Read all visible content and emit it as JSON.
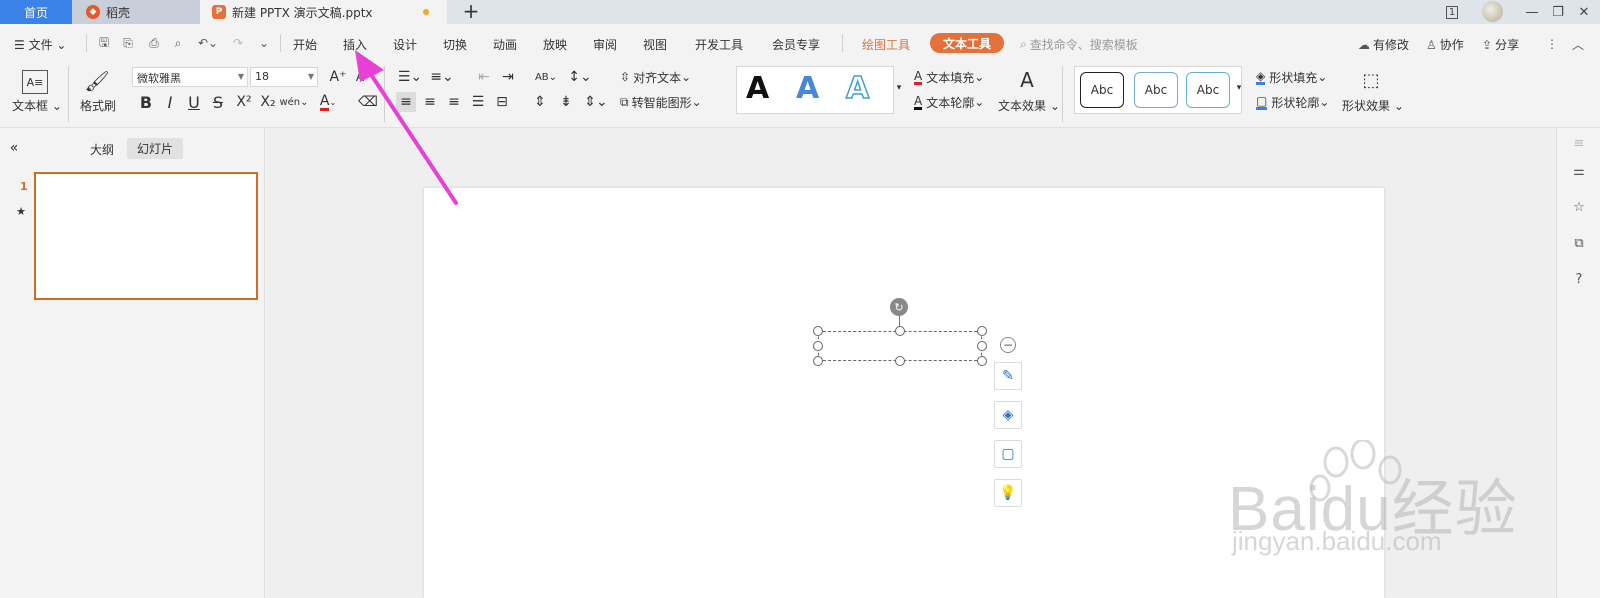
{
  "tabs": {
    "home": "首页",
    "daoke": "稻壳",
    "doc": "新建 PPTX 演示文稿.pptx"
  },
  "menu": {
    "file": "文件",
    "start": "开始",
    "insert": "插入",
    "design": "设计",
    "switch": "切换",
    "animate": "动画",
    "play": "放映",
    "review": "审阅",
    "view": "视图",
    "dev": "开发工具",
    "member": "会员专享",
    "draw_tools": "绘图工具",
    "text_tools": "文本工具",
    "search_placeholder": "查找命令、搜索模板",
    "modified": "有修改",
    "collab": "协作",
    "share": "分享"
  },
  "ribbon": {
    "textbox": "文本框",
    "format_painter": "格式刷",
    "font_name": "微软雅黑",
    "font_size": "18",
    "align_text": "对齐文本",
    "smart_shape": "转智能图形",
    "text_fill": "文本填充",
    "text_outline": "文本轮廓",
    "text_effect": "文本效果",
    "shape_fill": "形状填充",
    "shape_outline": "形状轮廓",
    "shape_effect": "形状效果",
    "abc": "Abc",
    "big_a": "A",
    "bold": "B",
    "italic": "I",
    "underline": "U",
    "strike": "S",
    "superscript": "X²",
    "subscript": "X₂",
    "pinyin": "wén"
  },
  "left_panel": {
    "outline": "大纲",
    "slides": "幻灯片",
    "slide_number": "1"
  },
  "watermark": {
    "brand": "Baidu经验",
    "url": "jingyan.baidu.com"
  },
  "colors": {
    "accent": "#e4703a",
    "tab_blue": "#3a82e8",
    "arrow": "#e83fd6"
  }
}
